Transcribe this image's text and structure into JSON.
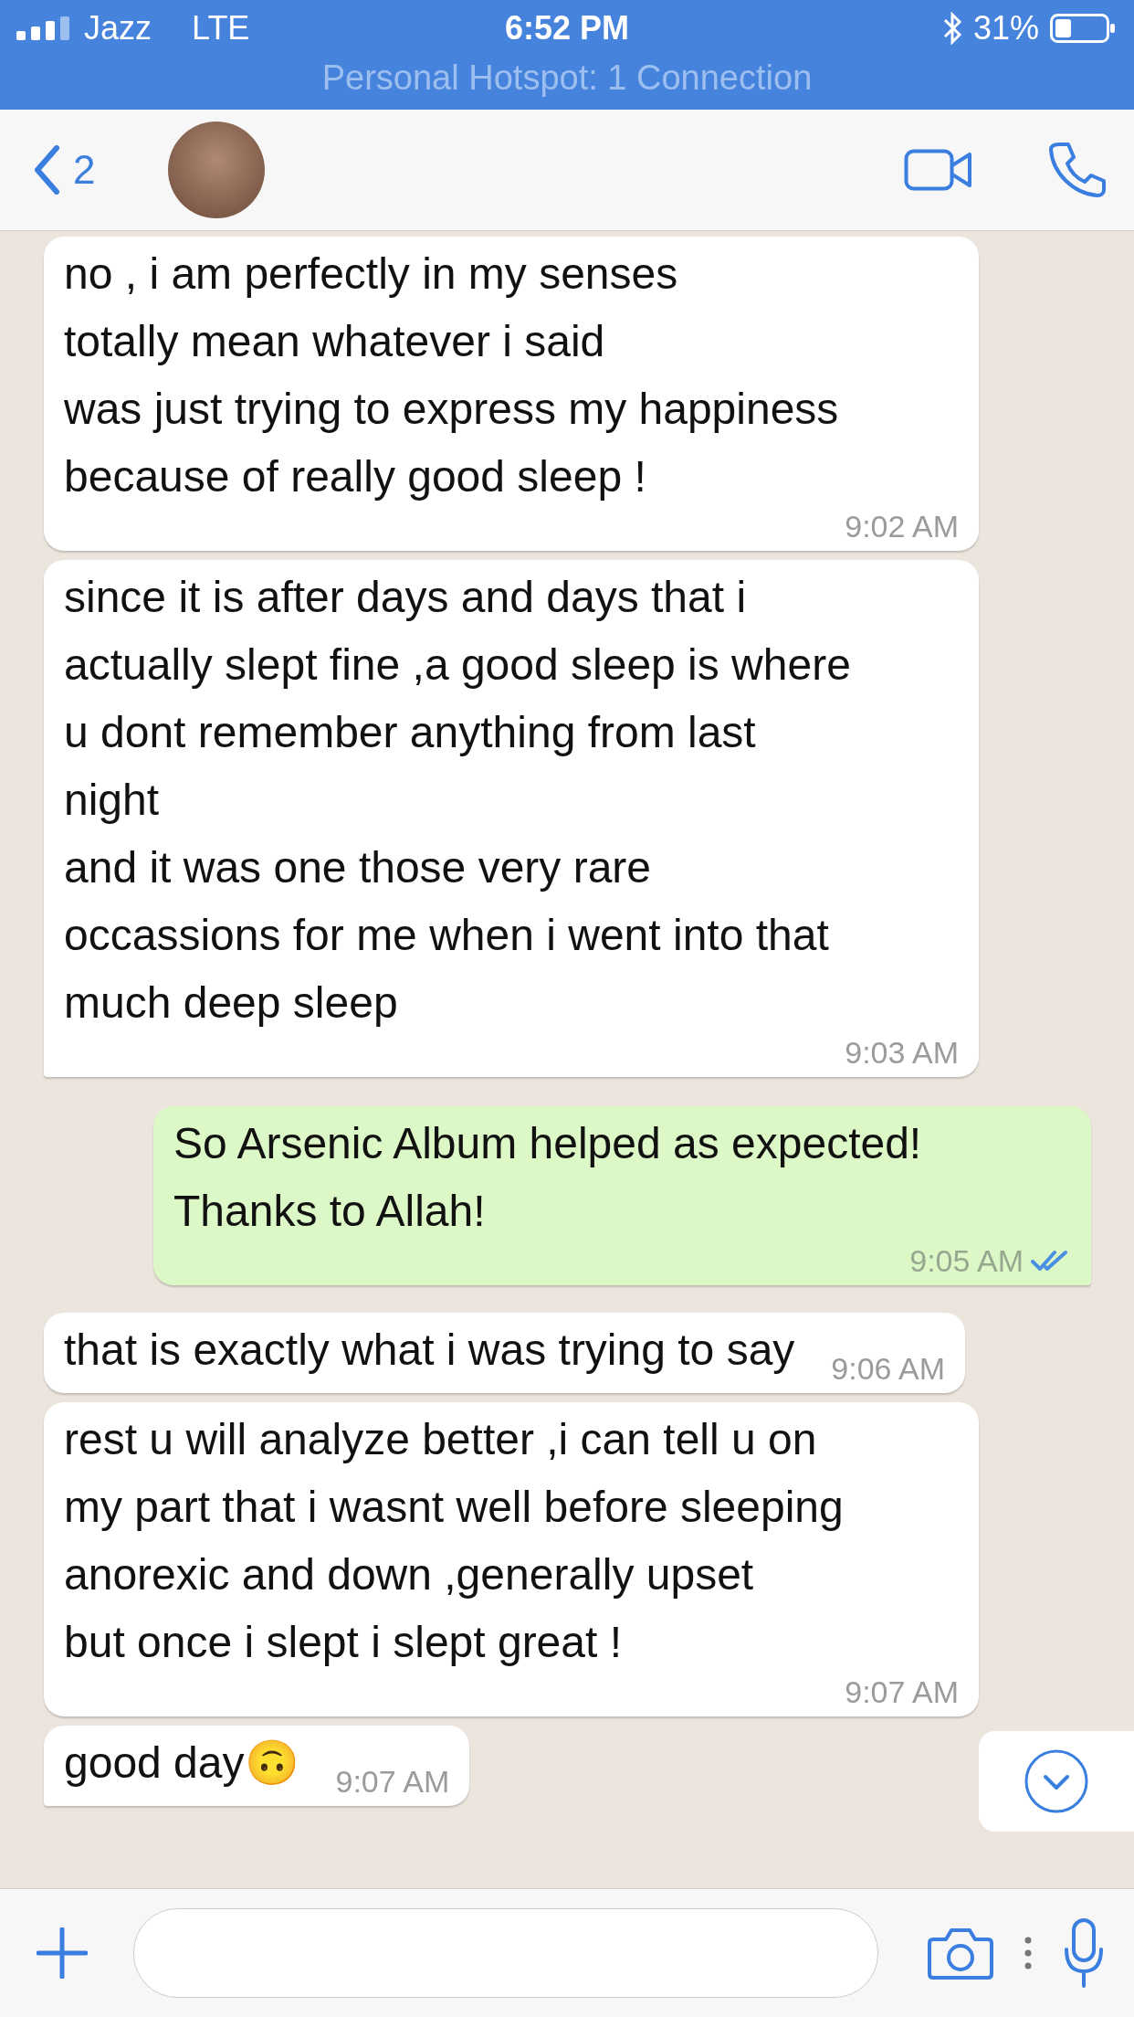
{
  "status_bar": {
    "carrier": "Jazz",
    "network": "LTE",
    "time": "6:52 PM",
    "battery": "31%",
    "hotspot": "Personal Hotspot: 1 Connection"
  },
  "header": {
    "back_count": "2"
  },
  "messages": [
    {
      "kind": "incoming",
      "text": "no , i am perfectly in my senses\ntotally mean whatever i said\nwas just trying to express my happiness\nbecause of really good sleep !",
      "time": "9:02 AM",
      "tail": false
    },
    {
      "kind": "incoming",
      "text": "since it is after days and days that i\nactually slept fine ,a good sleep is where\nu dont remember anything from last\nnight\nand it was one those very rare\noccassions for me when i went into that\nmuch deep sleep",
      "time": "9:03 AM",
      "tail": true
    },
    {
      "kind": "outgoing",
      "text": "So Arsenic Album helped as expected!\nThanks to Allah!",
      "time": "9:05 AM",
      "tail": true,
      "read": true
    },
    {
      "kind": "incoming",
      "text": "that is exactly what i was trying to say",
      "time": "9:06 AM",
      "tail": false
    },
    {
      "kind": "incoming",
      "text": "rest u will analyze better ,i can tell u on\nmy part that i wasnt well before sleeping\nanorexic and down ,generally upset\nbut once i slept i slept great !",
      "time": "9:07 AM",
      "tail": false
    },
    {
      "kind": "incoming",
      "text": "good day🙃",
      "time": "9:07 AM",
      "tail": true
    }
  ]
}
